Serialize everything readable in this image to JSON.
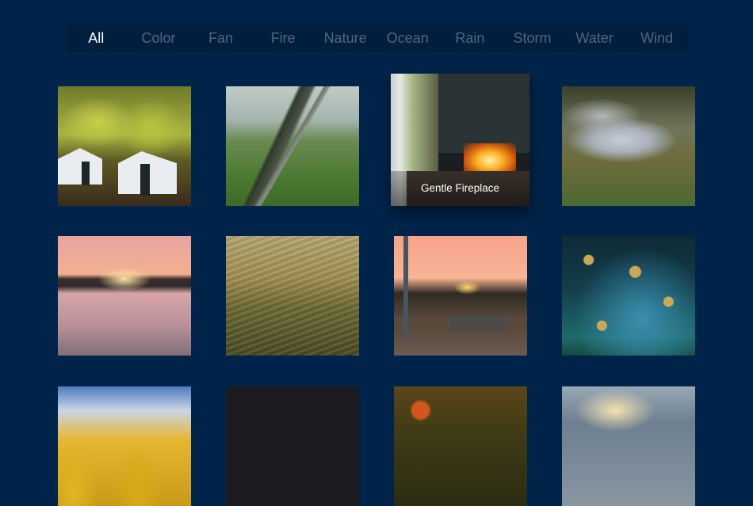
{
  "nav": {
    "active_index": 0,
    "tabs": [
      {
        "label": "All"
      },
      {
        "label": "Color"
      },
      {
        "label": "Fan"
      },
      {
        "label": "Fire"
      },
      {
        "label": "Nature"
      },
      {
        "label": "Ocean"
      },
      {
        "label": "Rain"
      },
      {
        "label": "Storm"
      },
      {
        "label": "Water"
      },
      {
        "label": "Wind"
      }
    ]
  },
  "grid": {
    "focused_title": "Gentle Fireplace",
    "tiles": [
      {
        "scene": "tents-in-autumn-forest"
      },
      {
        "scene": "foggy-railway-tracks"
      },
      {
        "scene": "fireplace",
        "title": "Gentle Fireplace",
        "focused": true
      },
      {
        "scene": "forest-creek-rocks"
      },
      {
        "scene": "lake-sunset"
      },
      {
        "scene": "wind-blown-grass"
      },
      {
        "scene": "boardwalk-bench-sunset"
      },
      {
        "scene": "rain-on-flowers"
      },
      {
        "scene": "yellow-aspens-blue-sky"
      },
      {
        "scene": "night-stars"
      },
      {
        "scene": "autumn-forest-path"
      },
      {
        "scene": "cloudy-sky"
      }
    ]
  },
  "colors": {
    "background": "#002449",
    "nav_background": "#001f3f",
    "tab_active": "#ffffff",
    "tab_inactive": "#4d6682"
  }
}
